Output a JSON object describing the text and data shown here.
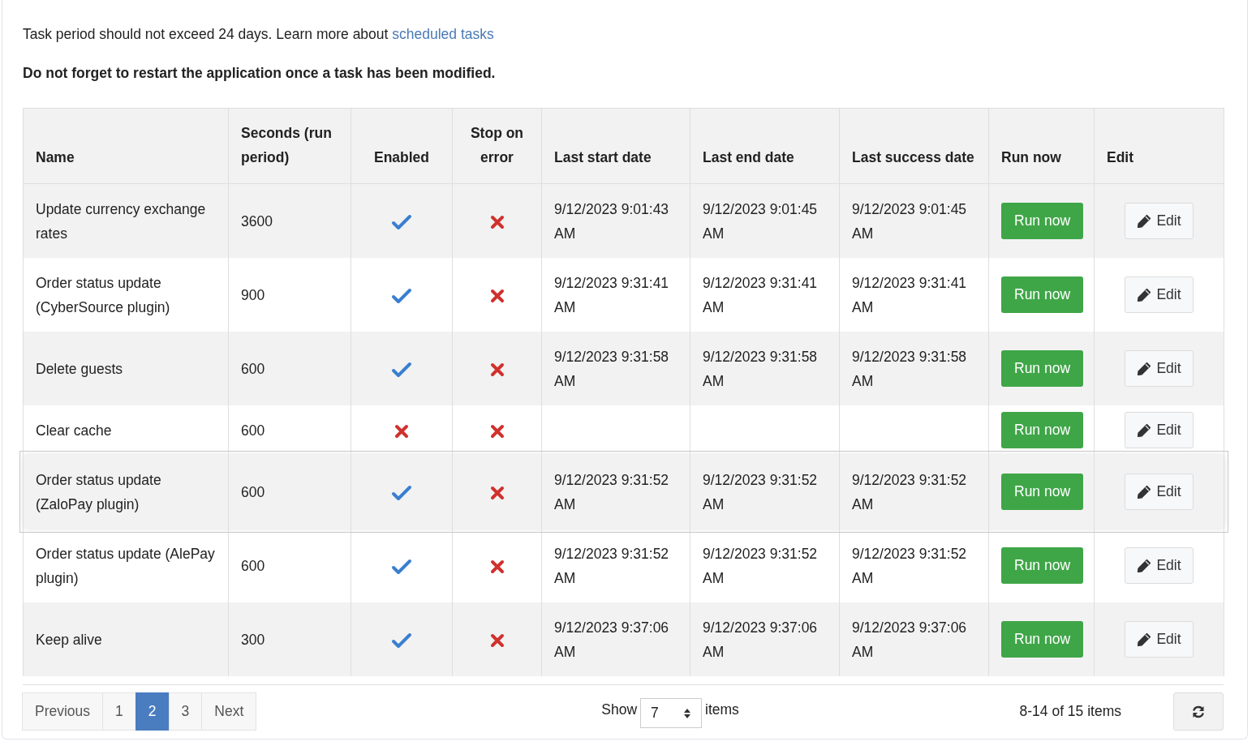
{
  "notice": {
    "text": "Task period should not exceed 24 days. Learn more about",
    "link": "scheduled tasks"
  },
  "warning": "Do not forget to restart the application once a task has been modified.",
  "table": {
    "columns": [
      "Name",
      "Seconds (run period)",
      "Enabled",
      "Stop on error",
      "Last start date",
      "Last end date",
      "Last success date",
      "Run now",
      "Edit"
    ],
    "rows": [
      {
        "name": "Update currency exchange rates",
        "seconds": "3600",
        "enabled": true,
        "stop_on_error": false,
        "last_start": "9/12/2023 9:01:43 AM",
        "last_end": "9/12/2023 9:01:45 AM",
        "last_success": "9/12/2023 9:01:45 AM",
        "run_label": "Run now",
        "edit_label": "Edit",
        "selected": false
      },
      {
        "name": "Order status update (CyberSource plugin)",
        "seconds": "900",
        "enabled": true,
        "stop_on_error": false,
        "last_start": "9/12/2023 9:31:41 AM",
        "last_end": "9/12/2023 9:31:41 AM",
        "last_success": "9/12/2023 9:31:41 AM",
        "run_label": "Run now",
        "edit_label": "Edit",
        "selected": false
      },
      {
        "name": "Delete guests",
        "seconds": "600",
        "enabled": true,
        "stop_on_error": false,
        "last_start": "9/12/2023 9:31:58 AM",
        "last_end": "9/12/2023 9:31:58 AM",
        "last_success": "9/12/2023 9:31:58 AM",
        "run_label": "Run now",
        "edit_label": "Edit",
        "selected": false
      },
      {
        "name": "Clear cache",
        "seconds": "600",
        "enabled": false,
        "stop_on_error": false,
        "run_label": "Run now",
        "edit_label": "Edit",
        "selected": false
      },
      {
        "name": "Order status update (ZaloPay plugin)",
        "seconds": "600",
        "enabled": true,
        "stop_on_error": false,
        "last_start": "9/12/2023 9:31:52 AM",
        "last_end": "9/12/2023 9:31:52 AM",
        "last_success": "9/12/2023 9:31:52 AM",
        "run_label": "Run now",
        "edit_label": "Edit",
        "selected": true
      },
      {
        "name": "Order status update (AlePay plugin)",
        "seconds": "600",
        "enabled": true,
        "stop_on_error": false,
        "last_start": "9/12/2023 9:31:52 AM",
        "last_end": "9/12/2023 9:31:52 AM",
        "last_success": "9/12/2023 9:31:52 AM",
        "run_label": "Run now",
        "edit_label": "Edit",
        "selected": false
      },
      {
        "name": "Keep alive",
        "seconds": "300",
        "enabled": true,
        "stop_on_error": false,
        "last_start": "9/12/2023 9:37:06 AM",
        "last_end": "9/12/2023 9:37:06 AM",
        "last_success": "9/12/2023 9:37:06 AM",
        "run_label": "Run now",
        "edit_label": "Edit",
        "selected": false
      }
    ]
  },
  "pagination": {
    "previous": "Previous",
    "pages": [
      {
        "label": "1",
        "selected": false
      },
      {
        "label": "2",
        "selected": true
      },
      {
        "label": "3",
        "selected": false
      }
    ],
    "next": "Next"
  },
  "page_size": {
    "label": "Show",
    "value": "7",
    "suffix": "items"
  },
  "summary": "8-14 of 15 items"
}
